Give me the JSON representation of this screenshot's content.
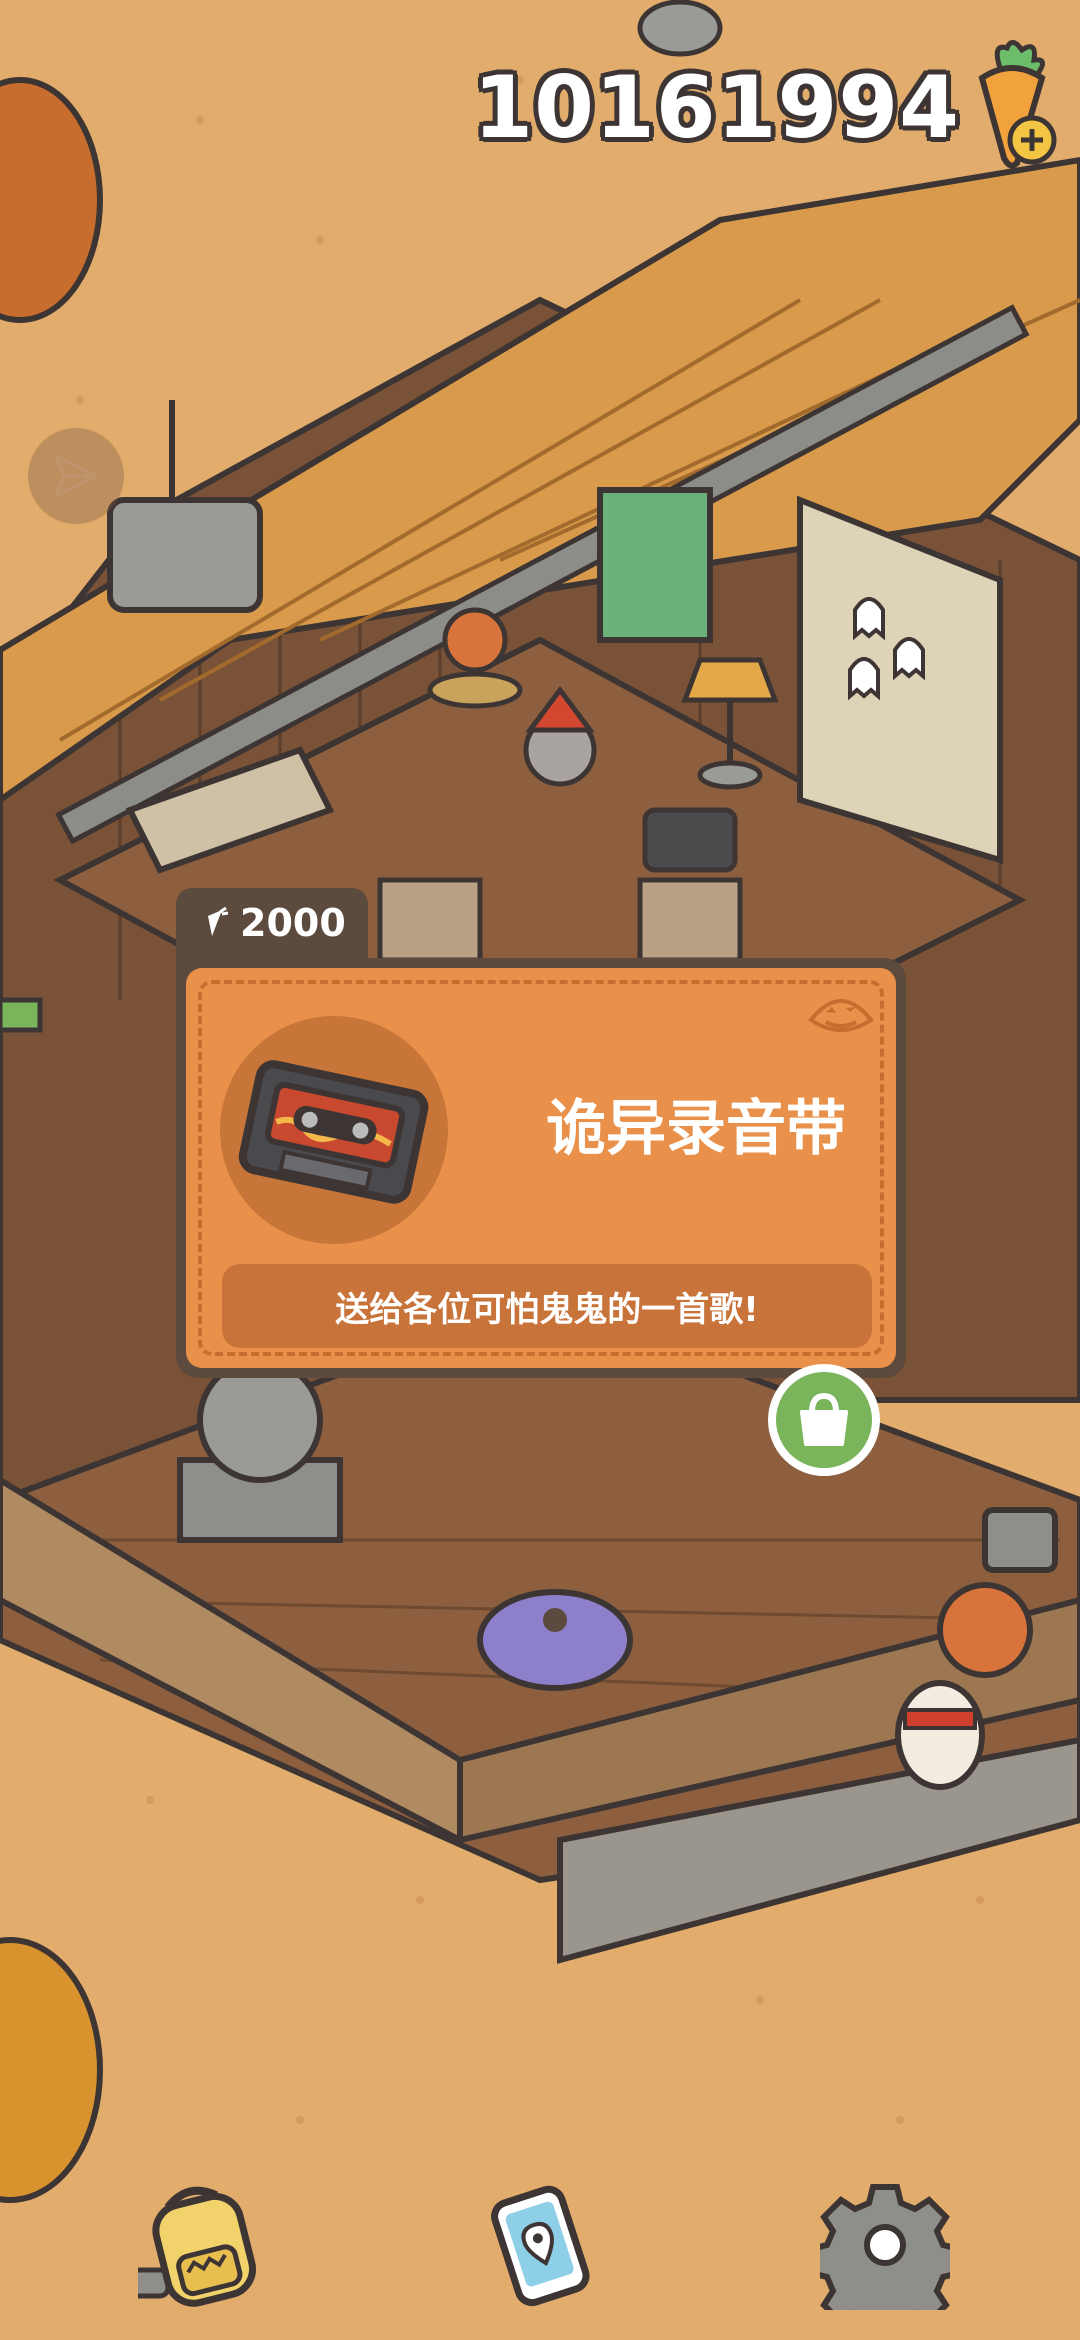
{
  "hud": {
    "currency_amount": "10161994",
    "currency_icon": "carrot-plus-icon",
    "share_icon": "paper-plane-icon"
  },
  "item_popup": {
    "price": "2000",
    "price_icon": "carrot-icon",
    "name": "诡异录音带",
    "description": "送给各位可怕鬼鬼的一首歌!",
    "item_icon": "cassette-tape-icon",
    "decoration_icon": "jack-o-lantern-icon",
    "buy_icon": "shopping-bag-icon"
  },
  "bottom_bar": {
    "items": [
      {
        "icon": "backpack-icon"
      },
      {
        "icon": "phone-map-icon"
      },
      {
        "icon": "gear-icon"
      }
    ]
  },
  "colors": {
    "ground": "#e2ac6c",
    "card_orange": "#e9914a",
    "card_border": "#5c4a3e",
    "buy_green": "#7ab55c"
  }
}
